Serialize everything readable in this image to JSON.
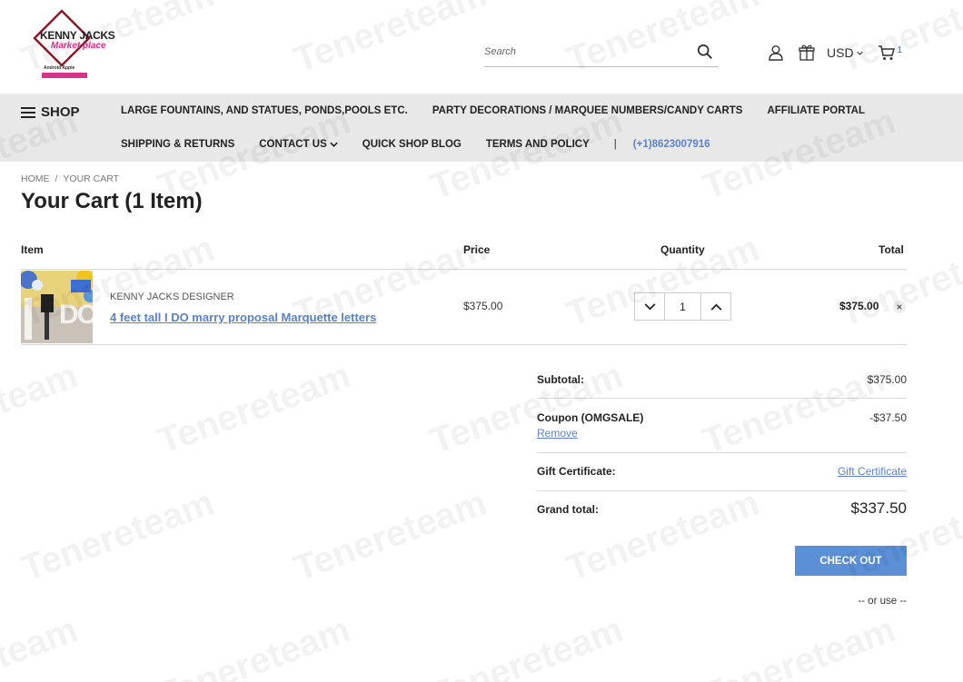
{
  "header": {
    "logo_line1": "KENNY JACKS",
    "logo_line2": "Market place",
    "logo_line3": "Android  Apple",
    "search_placeholder": "Search",
    "currency": "USD",
    "cart_count": "1"
  },
  "nav": {
    "shop_label": "SHOP",
    "row1": [
      "LARGE FOUNTAINS, AND STATUES, PONDS,POOLS ETC.",
      "PARTY DECORATIONS / MARQUEE NUMBERS/CANDY CARTS",
      "AFFILIATE PORTAL"
    ],
    "row2": [
      "SHIPPING & RETURNS",
      "CONTACT US",
      "QUICK SHOP BLOG",
      "TERMS AND POLICY"
    ],
    "separator": "|",
    "phone": "(+1)8623007916"
  },
  "breadcrumb": {
    "home": "HOME",
    "separator": "/",
    "current": "YOUR CART"
  },
  "page_title": "Your Cart (1 Item)",
  "cart": {
    "headers": {
      "item": "Item",
      "price": "Price",
      "quantity": "Quantity",
      "total": "Total"
    },
    "items": [
      {
        "brand": "KENNY JACKS DESIGNER",
        "name": "4 feet tall I DO marry proposal Marquette letters",
        "price": "$375.00",
        "quantity": "1",
        "total": "$375.00"
      }
    ],
    "thumb_text": "DO"
  },
  "summary": {
    "subtotal_label": "Subtotal:",
    "subtotal_value": "$375.00",
    "coupon_label": "Coupon (OMGSALE)",
    "coupon_value": "-$37.50",
    "coupon_remove": "Remove",
    "gift_label": "Gift Certificate:",
    "gift_link": "Gift Certificate",
    "grand_label": "Grand total:",
    "grand_value": "$337.50",
    "checkout_label": "CHECK OUT",
    "or_use": "-- or use --"
  },
  "watermark": {
    "text": "Tenereteam"
  },
  "colors": {
    "accent_link": "#5b82c9",
    "checkout_bg": "#5b8fd6",
    "nav_bg": "#e8e8e8",
    "logo_maroon": "#8b1a2b",
    "logo_pink": "#d6338a"
  }
}
